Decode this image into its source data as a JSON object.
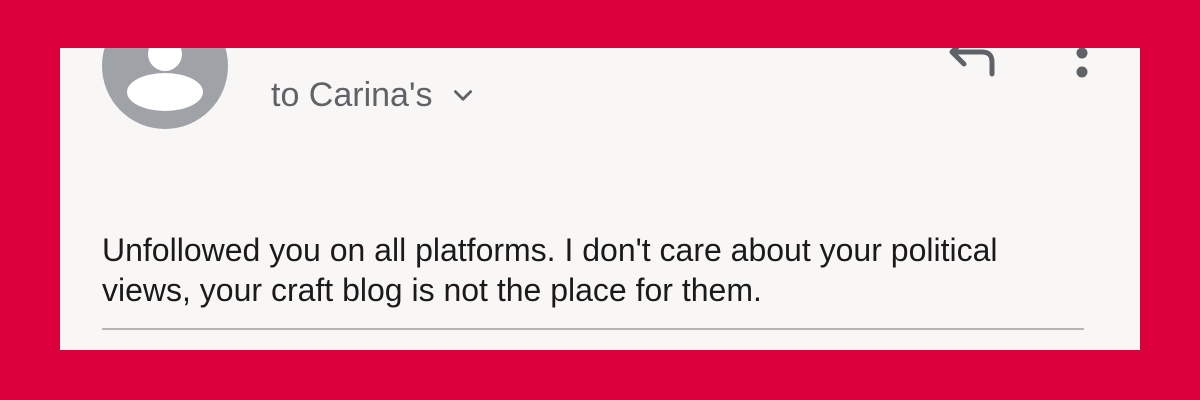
{
  "email": {
    "recipient_label": "to Carina's",
    "message": "Unfollowed you on all platforms. I don't care about your political views, your craft blog is not the place for them."
  },
  "icons": {
    "avatar": "person-avatar-icon",
    "recipients_toggle": "chevron-down-icon",
    "reply": "reply-icon",
    "more": "more-vert-icon"
  },
  "colors": {
    "background": "#dc003a",
    "card": "#f8f7f5",
    "avatar": "#9fa3a8",
    "secondary_text": "#5f6368",
    "body_text": "#1a1a1a",
    "divider": "#b5b5b5"
  }
}
